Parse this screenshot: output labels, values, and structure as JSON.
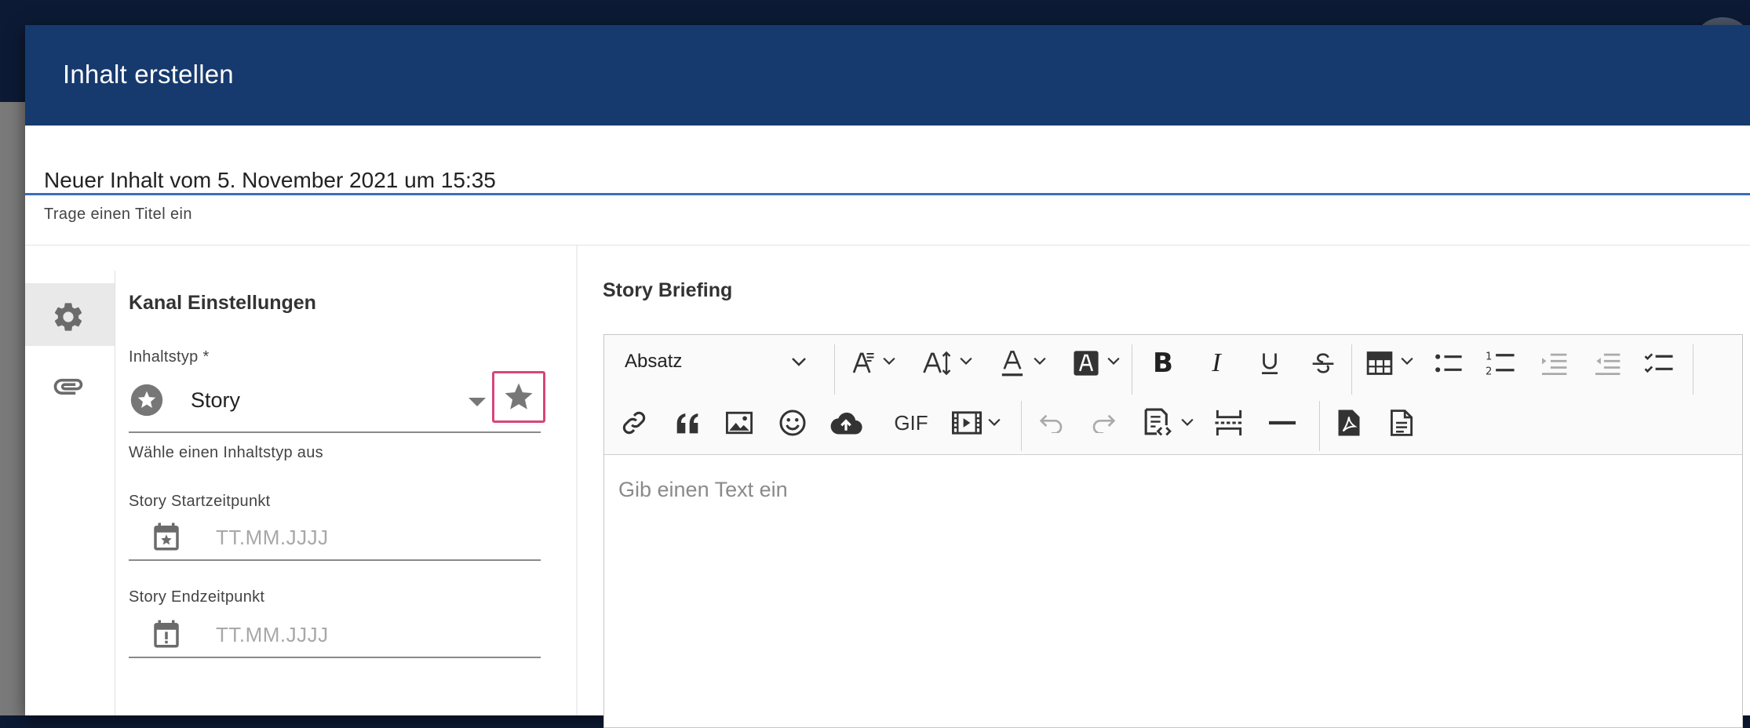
{
  "dialog": {
    "title": "Inhalt erstellen"
  },
  "title_field": {
    "value": "Neuer Inhalt vom 5. November 2021 um 15:35",
    "hint": "Trage einen Titel ein"
  },
  "rail": {
    "items": [
      {
        "icon": "gear-icon",
        "active": true
      },
      {
        "icon": "paperclip-icon",
        "active": false
      }
    ]
  },
  "channel_settings": {
    "title": "Kanal Einstellungen",
    "content_type": {
      "label": "Inhaltstyp *",
      "value": "Story",
      "hint": "Wähle einen Inhaltstyp aus",
      "icon": "star-circle-icon"
    },
    "start": {
      "label": "Story Startzeitpunkt",
      "placeholder": "TT.MM.JJJJ",
      "icon": "calendar-star-icon"
    },
    "end": {
      "label": "Story Endzeitpunkt",
      "placeholder": "TT.MM.JJJJ",
      "icon": "calendar-alert-icon"
    }
  },
  "briefing": {
    "title": "Story Briefing",
    "paragraph_format": "Absatz",
    "gif_label": "GIF",
    "placeholder": "Gib einen Text ein"
  },
  "colors": {
    "header": "#163a6e",
    "accent_line": "#3a6fb8",
    "highlight_box": "#d8457a"
  }
}
